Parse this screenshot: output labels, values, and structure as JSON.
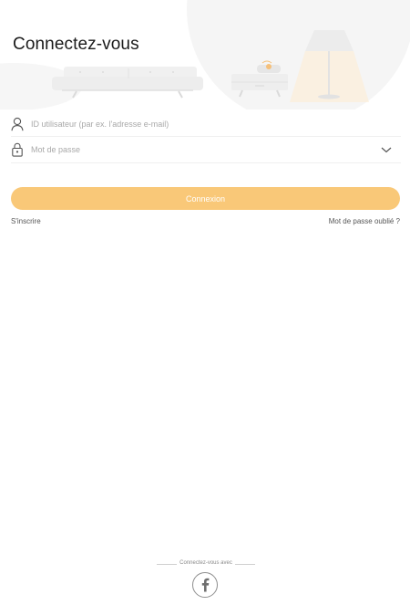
{
  "header": {
    "title": "Connectez-vous"
  },
  "form": {
    "user_placeholder": "ID utilisateur (par ex. l'adresse e-mail)",
    "password_placeholder": "Mot de passe",
    "login_label": "Connexion"
  },
  "links": {
    "signup": "S'inscrire",
    "forgot": "Mot de passe oublié ?"
  },
  "social": {
    "label": "Connectez-vous avec"
  },
  "icons": {
    "user": "user-icon",
    "lock": "lock-icon",
    "expand": "chevron-down-icon",
    "facebook": "facebook-icon"
  },
  "colors": {
    "accent": "#f9c878",
    "lamp_glow": "#fde7c5",
    "illustration": "#f1f1f1"
  }
}
